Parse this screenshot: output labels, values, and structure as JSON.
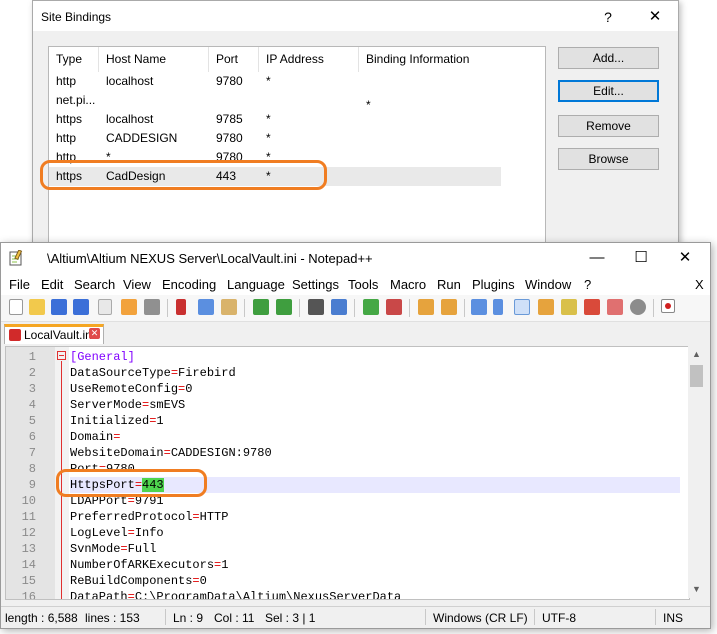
{
  "site_bindings": {
    "title": "Site Bindings",
    "help_glyph": "?",
    "close_glyph": "✕",
    "columns": [
      "Type",
      "Host Name",
      "Port",
      "IP Address",
      "Binding Information"
    ],
    "rows": [
      [
        "http",
        "localhost",
        "9780",
        "*",
        ""
      ],
      [
        "net.pi...",
        "",
        "",
        "",
        "*"
      ],
      [
        "https",
        "localhost",
        "9785",
        "*",
        ""
      ],
      [
        "http",
        "CADDESIGN",
        "9780",
        "*",
        ""
      ],
      [
        "http",
        "*",
        "9780",
        "*",
        ""
      ],
      [
        "https",
        "CadDesign",
        "443",
        "*",
        ""
      ]
    ],
    "buttons": [
      "Add...",
      "Edit...",
      "Remove",
      "Browse"
    ],
    "selected_row": 5,
    "highlight_color": "#f07d22"
  },
  "notepad": {
    "title": "\\Altium\\Altium NEXUS Server\\LocalVault.ini - Notepad++",
    "window_controls": [
      "—",
      "☐",
      "✕"
    ],
    "menu": [
      "File",
      "Edit",
      "Search",
      "View",
      "Encoding",
      "Language",
      "Settings",
      "Tools",
      "Macro",
      "Run",
      "Plugins",
      "Window",
      "?"
    ],
    "menu_close": "X",
    "tab": {
      "label": "LocalVault.ini",
      "close_glyph": "✕"
    },
    "lines": [
      {
        "n": "1",
        "key": "[General]",
        "eq": "",
        "val": "",
        "section": true
      },
      {
        "n": "2",
        "key": "DataSourceType",
        "eq": "=",
        "val": "Firebird"
      },
      {
        "n": "3",
        "key": "UseRemoteConfig",
        "eq": "=",
        "val": "0"
      },
      {
        "n": "4",
        "key": "ServerMode",
        "eq": "=",
        "val": "smEVS"
      },
      {
        "n": "5",
        "key": "Initialized",
        "eq": "=",
        "val": "1"
      },
      {
        "n": "6",
        "key": "Domain",
        "eq": "=",
        "val": ""
      },
      {
        "n": "7",
        "key": "WebsiteDomain",
        "eq": "=",
        "val": "CADDESIGN:9780"
      },
      {
        "n": "8",
        "key": "Port",
        "eq": "=",
        "val": "9780"
      },
      {
        "n": "9",
        "key": "HttpsPort",
        "eq": "=",
        "val": "443",
        "current": true
      },
      {
        "n": "10",
        "key": "LDAPPort",
        "eq": "=",
        "val": "9791"
      },
      {
        "n": "11",
        "key": "PreferredProtocol",
        "eq": "=",
        "val": "HTTP"
      },
      {
        "n": "12",
        "key": "LogLevel",
        "eq": "=",
        "val": "Info"
      },
      {
        "n": "13",
        "key": "SvnMode",
        "eq": "=",
        "val": "Full"
      },
      {
        "n": "14",
        "key": "NumberOfARKExecutors",
        "eq": "=",
        "val": "1"
      },
      {
        "n": "15",
        "key": "ReBuildComponents",
        "eq": "=",
        "val": "0"
      },
      {
        "n": "16",
        "key": "DataPath",
        "eq": "=",
        "val": "C:\\ProgramData\\Altium\\NexusServerData"
      }
    ],
    "status": {
      "length": "length : 6,588",
      "lines": "lines : 153",
      "ln": "Ln : 9",
      "col": "Col : 11",
      "sel": "Sel : 3 | 1",
      "eol": "Windows (CR LF)",
      "encoding": "UTF-8",
      "mode": "INS"
    }
  }
}
